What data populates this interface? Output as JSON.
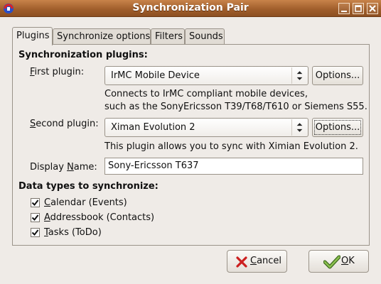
{
  "window": {
    "title": "Synchronization Pair",
    "controls": [
      "minimize",
      "maximize",
      "close"
    ]
  },
  "tabs": [
    {
      "label": "Plugins",
      "active": true
    },
    {
      "label": "Synchronize options",
      "active": false
    },
    {
      "label": "Filters",
      "active": false
    },
    {
      "label": "Sounds",
      "active": false
    }
  ],
  "plugins_section": {
    "heading": "Synchronization plugins:",
    "first": {
      "label_prefix": "F",
      "label_rest": "irst plugin:",
      "value": "IrMC Mobile Device",
      "options_label": "Options...",
      "desc_line1": "Connects to IrMC compliant mobile devices,",
      "desc_line2": "such as the SonyEricsson T39/T68/T610 or Siemens S55."
    },
    "second": {
      "label_prefix": "S",
      "label_rest": "econd plugin:",
      "value": "Ximan Evolution 2",
      "options_label": "Options...",
      "desc_line1": "This plugin allows you to sync with Ximian Evolution 2."
    },
    "display_name": {
      "label_before": "Display ",
      "label_mnemonic": "N",
      "label_after": "ame:",
      "value": "Sony-Ericsson T637"
    }
  },
  "datatypes": {
    "heading": "Data types to synchronize:",
    "items": [
      {
        "mnemonic": "C",
        "rest": "alendar (Events)",
        "checked": true
      },
      {
        "mnemonic": "A",
        "rest": "ddressbook (Contacts)",
        "checked": true
      },
      {
        "mnemonic": "T",
        "rest": "asks (ToDo)",
        "checked": true
      }
    ]
  },
  "buttons": {
    "cancel_mnemonic": "C",
    "cancel_rest": "ancel",
    "ok_mnemonic": "O",
    "ok_rest": "K"
  },
  "colors": {
    "titlebar": "#a15f2c",
    "dialog_bg": "#efebe7",
    "cancel_icon": "#cc1f1f",
    "ok_icon": "#6a9a3a"
  },
  "icons": {
    "app": "sync-app-icon",
    "cancel": "cancel-x-icon",
    "ok": "ok-check-icon",
    "combo": "combo-arrows-icon"
  }
}
